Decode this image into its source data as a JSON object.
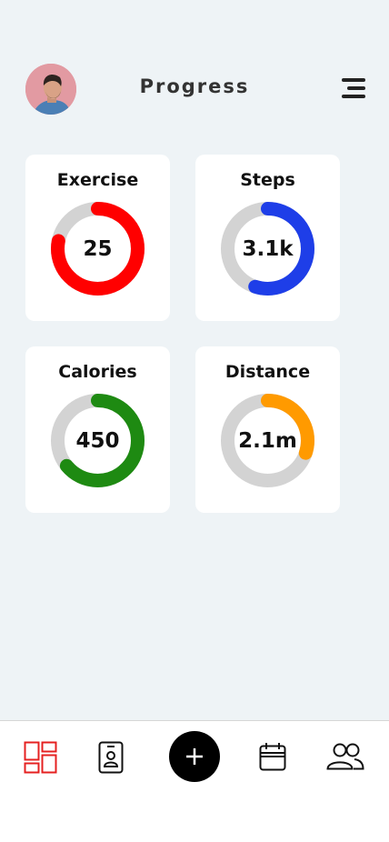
{
  "header": {
    "title": "Progress",
    "avatar_icon": "user-avatar",
    "menu_icon": "hamburger-menu-icon"
  },
  "stats": [
    {
      "key": "exercise",
      "label": "Exercise",
      "value": "25",
      "progress": 0.78,
      "color": "#ff0000"
    },
    {
      "key": "steps",
      "label": "Steps",
      "value": "3.1k",
      "progress": 0.55,
      "color": "#1e3ee8"
    },
    {
      "key": "calories",
      "label": "Calories",
      "value": "450",
      "progress": 0.64,
      "color": "#1e8a12"
    },
    {
      "key": "distance",
      "label": "Distance",
      "value": "2.1m",
      "progress": 0.3,
      "color": "#ff9a00"
    }
  ],
  "ring_track_color": "#d3d3d3",
  "nav": {
    "items": [
      {
        "key": "dashboard",
        "icon": "dashboard-icon",
        "active": true
      },
      {
        "key": "profile",
        "icon": "id-badge-icon",
        "active": false
      },
      {
        "key": "add",
        "icon": "plus-icon",
        "active": false
      },
      {
        "key": "calendar",
        "icon": "calendar-icon",
        "active": false
      },
      {
        "key": "users",
        "icon": "users-icon",
        "active": false
      }
    ],
    "active_color": "#e52020"
  }
}
